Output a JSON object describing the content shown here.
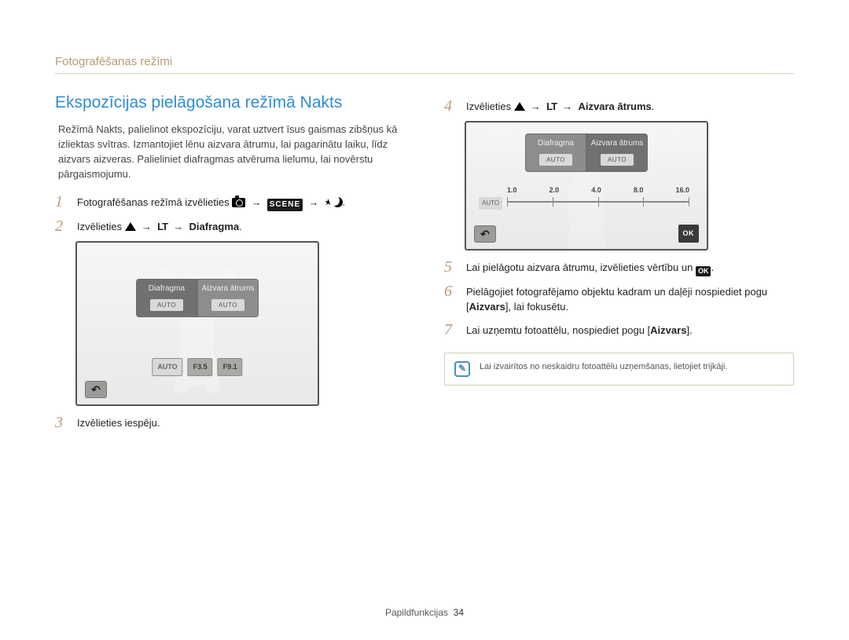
{
  "header": "Fotografēšanas režīmi",
  "title": "Ekspozīcijas pielāgošana režīmā Nakts",
  "intro": "Režīmā Nakts, palielinot ekspozīciju, varat uztvert īsus gaismas zibšņus kā izliektas svītras. Izmantojiet lēnu aizvara ātrumu, lai pagarinātu laiku, līdz aizvars aizveras. Palieliniet diafragmas atvēruma lielumu, lai novērstu pārgaismojumu.",
  "steps": {
    "s1_pre": "Fotografēšanas režīmā izvēlieties ",
    "s2_pre": "Izvēlieties ",
    "s2_bold": "Diafragma",
    "s3": "Izvēlieties iespēju.",
    "s4_pre": "Izvēlieties ",
    "s4_bold": "Aizvara ātrums",
    "s5_pre": "Lai pielāgotu aizvara ātrumu, izvēlieties vērtību un ",
    "s6_a": "Pielāgojiet fotografējamo objektu kadram un daļēji nospiediet pogu [",
    "s6_bold": "Aizvars",
    "s6_b": "], lai fokusētu.",
    "s7_a": "Lai uzņemtu fotoattēlu, nospiediet pogu [",
    "s7_bold": "Aizvars",
    "s7_b": "]."
  },
  "screen": {
    "tab1": "Diafragma",
    "tab2": "Aizvara ātrums",
    "auto": "AUTO",
    "chip1": "F3.5",
    "chip2": "F9.1",
    "ok": "OK"
  },
  "slider": {
    "labels": [
      "1.0",
      "2.0",
      "4.0",
      "8.0",
      "16.0"
    ]
  },
  "icons": {
    "scene": "SCENE",
    "lt": "LT",
    "ok": "OK"
  },
  "note": "Lai izvairītos no neskaidru fotoattēlu uzņemšanas, lietojiet trijkāji.",
  "footer": {
    "section": "Papildfunkcijas",
    "page": "34"
  }
}
